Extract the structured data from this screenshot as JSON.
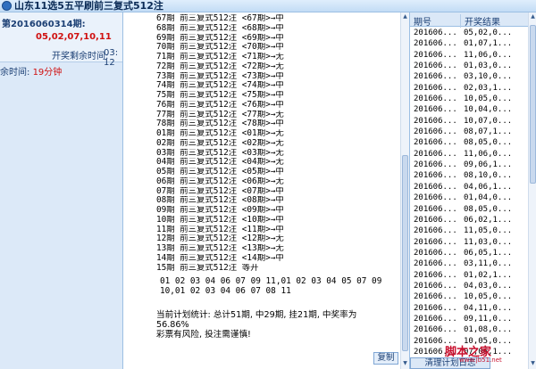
{
  "window": {
    "title": "山东11选5五平刷前三复式512注"
  },
  "left_panel": {
    "issue_title": "第2016060314期:",
    "issue_numbers": "05,02,07,10,11",
    "draw_time_label": "开奖剩余时间:",
    "draw_time_value": "03: 12",
    "remaining_label": "余时间: ",
    "remaining_value": "19分钟"
  },
  "plan_rows": [
    "67期 前三复式512注 <67期>→中",
    "68期 前三复式512注 <68期>→中",
    "69期 前三复式512注 <69期>→中",
    "70期 前三复式512注 <70期>→中",
    "71期 前三复式512注 <71期>→无",
    "72期 前三复式512注 <72期>→无",
    "73期 前三复式512注 <73期>→中",
    "74期 前三复式512注 <74期>→中",
    "75期 前三复式512注 <75期>→中",
    "76期 前三复式512注 <76期>→中",
    "77期 前三复式512注 <77期>→无",
    "78期 前三复式512注 <78期>→中",
    "01期 前三复式512注 <01期>→无",
    "02期 前三复式512注 <02期>→无",
    "03期 前三复式512注 <03期>→无",
    "04期 前三复式512注 <04期>→无",
    "05期 前三复式512注 <05期>→中",
    "06期 前三复式512注 <06期>→无",
    "07期 前三复式512注 <07期>→中",
    "08期 前三复式512注 <08期>→中",
    "09期 前三复式512注 <09期>→中",
    "10期 前三复式512注 <10期>→中",
    "11期 前三复式512注 <11期>→中",
    "12期 前三复式512注 <12期>→无",
    "13期 前三复式512注 <13期>→无",
    "14期 前三复式512注 <14期>→中",
    "15期 前三复式512注 等开"
  ],
  "numbers_text": {
    "line1": "01 02 03 04 06 07 09 11,01 02 03 04 05 07 09",
    "line2": "10,01 02 03 04 06 07 08 11"
  },
  "stats": {
    "line1": "当前计划统计: 总计51期, 中29期, 挂21期, 中奖率为",
    "line2": "56.86%",
    "line3": "彩票有风险, 投注需谨慎!"
  },
  "copy_label": "复制",
  "table": {
    "header_issue": "期号",
    "header_result": "开奖结果",
    "rows": [
      [
        "201606...",
        "05,02,0..."
      ],
      [
        "201606...",
        "01,07,1..."
      ],
      [
        "201606...",
        "11,06,0..."
      ],
      [
        "201606...",
        "01,03,0..."
      ],
      [
        "201606...",
        "03,10,0..."
      ],
      [
        "201606...",
        "02,03,1..."
      ],
      [
        "201606...",
        "10,05,0..."
      ],
      [
        "201606...",
        "10,04,0..."
      ],
      [
        "201606...",
        "10,07,0..."
      ],
      [
        "201606...",
        "08,07,1..."
      ],
      [
        "201606...",
        "08,05,0..."
      ],
      [
        "201606...",
        "11,06,0..."
      ],
      [
        "201606...",
        "09,06,1..."
      ],
      [
        "201606...",
        "08,10,0..."
      ],
      [
        "201606...",
        "04,06,1..."
      ],
      [
        "201606...",
        "01,04,0..."
      ],
      [
        "201606...",
        "08,05,0..."
      ],
      [
        "201606...",
        "06,02,1..."
      ],
      [
        "201606...",
        "11,05,0..."
      ],
      [
        "201606...",
        "11,03,0..."
      ],
      [
        "201606...",
        "06,05,1..."
      ],
      [
        "201606...",
        "03,11,0..."
      ],
      [
        "201606...",
        "01,02,1..."
      ],
      [
        "201606...",
        "04,03,0..."
      ],
      [
        "201606...",
        "10,05,0..."
      ],
      [
        "201606...",
        "04,11,0..."
      ],
      [
        "201606...",
        "09,11,0..."
      ],
      [
        "201606...",
        "01,08,0..."
      ],
      [
        "201606...",
        "10,05,0..."
      ],
      [
        "201606...",
        "07,06,1..."
      ]
    ]
  },
  "clear_label": "清理计划日志",
  "watermark": {
    "text": "脚本之家",
    "url": "www.jb51.net"
  }
}
